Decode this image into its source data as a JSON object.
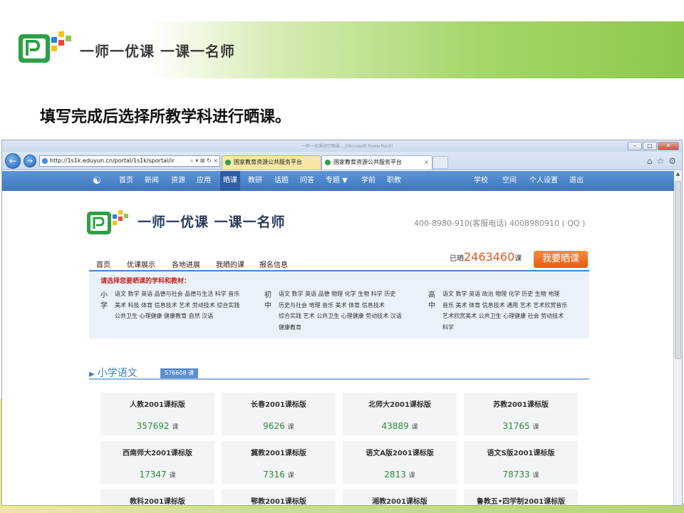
{
  "slide": {
    "logo_text": "一师一优课 一课一名师",
    "heading": "填写完成后选择所教学科进行晒课。"
  },
  "browser": {
    "title_text": "一师一优课进行晒课 ...(Microsoft PowerPoint)",
    "address": "http://1s1k.eduyun.cn/portal/1s1k/sportal/ir",
    "address_tools": "⌕ ▾ ⊠ ↻ ×",
    "tabs": [
      {
        "label": "国家教育资源公共服务平台"
      },
      {
        "label": "国家教育资源公共服务平台"
      }
    ],
    "tab_close": "×"
  },
  "site_nav": {
    "items": [
      "首页",
      "新闻",
      "资源",
      "应用",
      "晒课",
      "教研",
      "话题",
      "问答",
      "专题 ▼",
      "学前",
      "职教"
    ],
    "right_items": [
      "学校",
      "空间",
      "个人设置",
      "退出"
    ]
  },
  "site_header": {
    "logo_text": "一师一优课 一课一名师",
    "contact": "400-8980-910(客服电话)  4008980910 ( QQ )"
  },
  "sub_nav": {
    "items": [
      "首页",
      "优课展示",
      "各地进展",
      "我晒的课",
      "报名信息"
    ],
    "shown_prefix": "已晒",
    "shown_count": "2463460",
    "shown_suffix": "课",
    "cta": "我要晒课"
  },
  "subjects": {
    "prompt": "请选择您要晒课的学科和教材：",
    "levels": [
      {
        "label": "小学",
        "lines": [
          "语文 数学 英语 品德与社会 品德与生活 科学 音乐",
          "美术 科技 体育 信息技术 艺术 劳动技术 综合实践",
          "公共卫生 心理健康 健康教育 自然 汉语"
        ]
      },
      {
        "label": "初中",
        "lines": [
          "语文 数学 英语 品德 物理 化学 生物 科学 历史",
          "历史与社会 地理 音乐 美术 体育 信息技术",
          "综合实践 艺术 公共卫生 心理健康 劳动技术 汉语",
          "健康教育"
        ]
      },
      {
        "label": "高中",
        "lines": [
          "语文 数学 英语 政治 物理 化学 历史 生物 地理",
          "音乐 美术 体育 信息技术 通用 艺术 艺术欣赏音乐",
          "艺术欣赏美术 公共卫生 心理健康 社会 劳动技术",
          "科学"
        ]
      }
    ]
  },
  "section": {
    "title": "小学语文",
    "badge": "576608 课"
  },
  "cards": [
    {
      "name": "人教2001课标版",
      "count": "357692",
      "unit": "课"
    },
    {
      "name": "长春2001课标版",
      "count": "9626",
      "unit": "课"
    },
    {
      "name": "北师大2001课标版",
      "count": "43889",
      "unit": "课"
    },
    {
      "name": "苏教2001课标版",
      "count": "31765",
      "unit": "课"
    },
    {
      "name": "西南师大2001课标版",
      "count": "17347",
      "unit": "课"
    },
    {
      "name": "冀教2001课标版",
      "count": "7316",
      "unit": "课"
    },
    {
      "name": "语文A版2001课标版",
      "count": "2813",
      "unit": "课"
    },
    {
      "name": "语文S版2001课标版",
      "count": "78733",
      "unit": "课"
    },
    {
      "name": "教科2001课标版",
      "count": "",
      "unit": ""
    },
    {
      "name": "鄂教2001课标版",
      "count": "",
      "unit": ""
    },
    {
      "name": "湘教2001课标版",
      "count": "",
      "unit": ""
    },
    {
      "name": "鲁教五•四学制2001课标版",
      "count": "",
      "unit": ""
    }
  ],
  "colors": {
    "site_nav": "#3f77bf",
    "accent_orange": "#e85c12",
    "count_green": "#2f8a3c",
    "prompt_red": "#c0231c"
  }
}
